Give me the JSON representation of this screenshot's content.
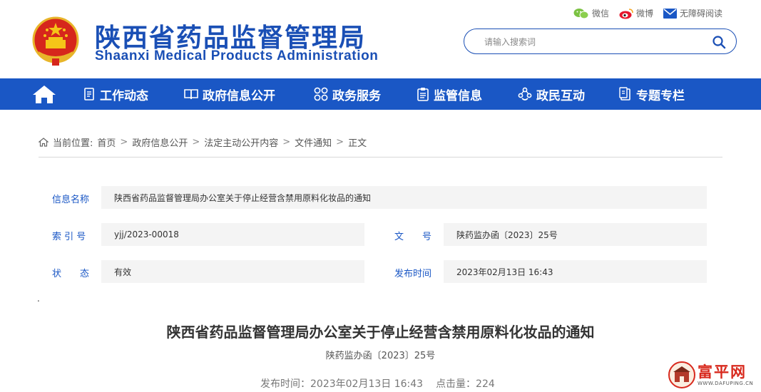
{
  "header": {
    "title_cn": "陕西省药品监督管理局",
    "title_en": "Shaanxi Medical Products Administration",
    "top_links": [
      {
        "label": "微信",
        "icon": "wechat-icon"
      },
      {
        "label": "微博",
        "icon": "weibo-icon"
      },
      {
        "label": "无障碍阅读",
        "icon": "mail-icon"
      }
    ],
    "search": {
      "placeholder": "请输入搜索词"
    }
  },
  "nav": {
    "items": [
      {
        "label": "工作动态",
        "icon": "document-icon"
      },
      {
        "label": "政府信息公开",
        "icon": "book-icon"
      },
      {
        "label": "政务服务",
        "icon": "grid-icon"
      },
      {
        "label": "监管信息",
        "icon": "clipboard-icon"
      },
      {
        "label": "政民互动",
        "icon": "interaction-icon"
      },
      {
        "label": "专题专栏",
        "icon": "folder-icon"
      }
    ]
  },
  "breadcrumb": {
    "prefix": "当前位置:",
    "items": [
      "首页",
      "政府信息公开",
      "法定主动公开内容",
      "文件通知",
      "正文"
    ]
  },
  "info": {
    "name_label": "信息名称",
    "name_value": "陕西省药品监督管理局办公室关于停止经营含禁用原料化妆品的通知",
    "index_label": "索 引 号",
    "index_value": "yjj/2023-00018",
    "docno_label": "文　　号",
    "docno_value": "陕药监办函〔2023〕25号",
    "status_label": "状　　态",
    "status_value": "有效",
    "date_label": "发布时间",
    "date_value": "2023年02月13日 16:43"
  },
  "article": {
    "dot": ".",
    "title": "陕西省药品监督管理局办公室关于停止经营含禁用原料化妆品的通知",
    "doc_number": "陕药监办函〔2023〕25号",
    "publish_time": "发布时间：2023年02月13日 16:43",
    "views": "点击量：224"
  },
  "watermark": {
    "text": "富平网",
    "url": "WWW.DAFUPING.CN"
  },
  "colors": {
    "brand_blue": "#1a57c5",
    "title_blue": "#1a4fb5",
    "emblem_red": "#d6261c",
    "watermark_red": "#d82a1e"
  }
}
